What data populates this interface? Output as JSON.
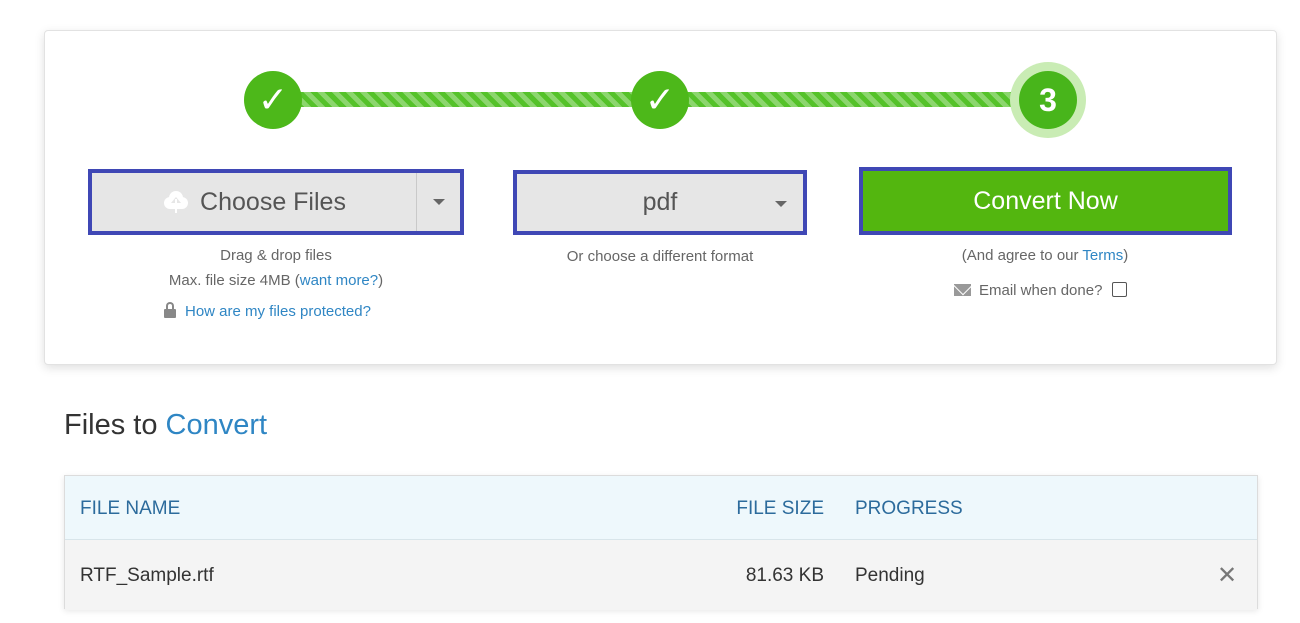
{
  "steps": [
    {
      "label": "✓",
      "state": "done"
    },
    {
      "label": "✓",
      "state": "done"
    },
    {
      "label": "3",
      "state": "current"
    }
  ],
  "choose_files": {
    "label": "Choose Files",
    "hint_line1": "Drag & drop files",
    "max_size_prefix": "Max. file size 4MB (",
    "want_more_link": "want more?",
    "max_size_suffix": ")",
    "protected_link": "How are my files protected?"
  },
  "format": {
    "selected": "pdf",
    "hint": "Or choose a different format"
  },
  "convert": {
    "label": "Convert Now",
    "agree_prefix": "(And agree to our ",
    "terms_link": "Terms",
    "agree_suffix": ")",
    "email_label": "Email when done?"
  },
  "files_section": {
    "heading_prefix": "Files to",
    "heading_accent": "Convert"
  },
  "table": {
    "headers": {
      "file_name": "FILE NAME",
      "file_size": "FILE SIZE",
      "progress": "PROGRESS"
    },
    "rows": [
      {
        "file_name": "RTF_Sample.rtf",
        "file_size": "81.63 KB",
        "progress": "Pending",
        "remove": "✕"
      }
    ]
  },
  "colors": {
    "accent_green": "#53b60f",
    "outline_blue": "#3f47b5",
    "link_blue": "#2f86c4"
  }
}
